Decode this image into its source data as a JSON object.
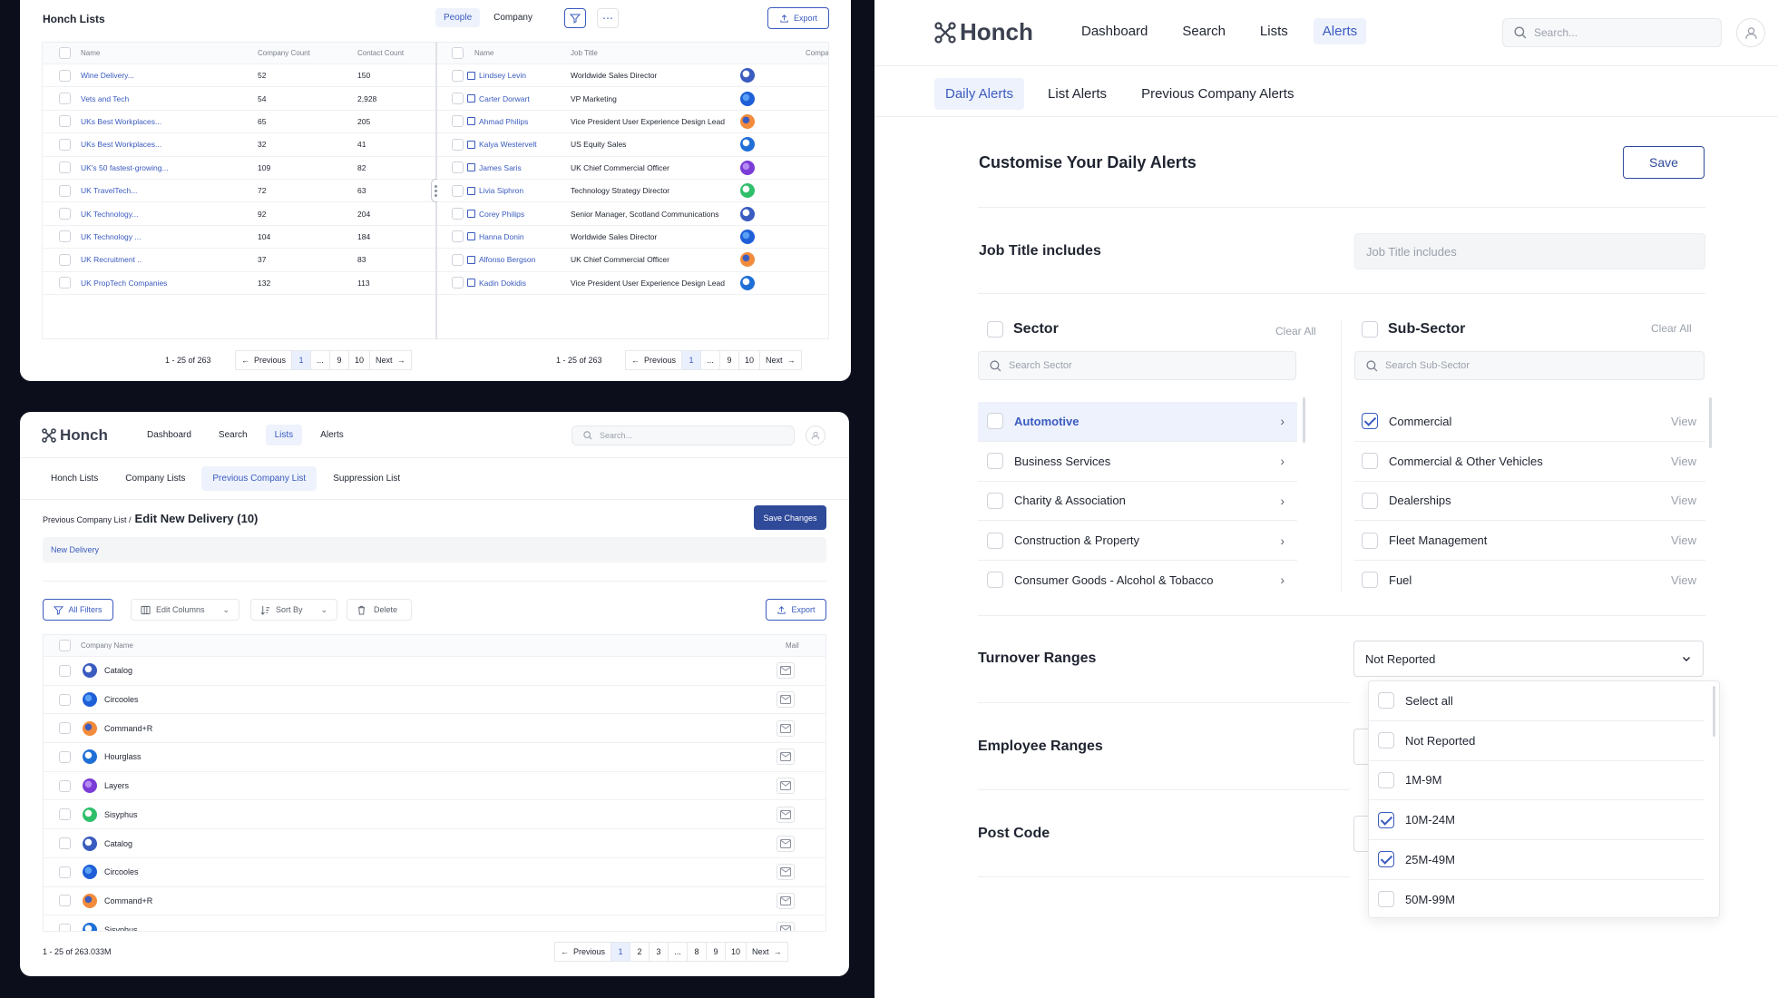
{
  "honch_lists": {
    "title": "Honch Lists",
    "toggle": {
      "people": "People",
      "company": "Company"
    },
    "export": "Export",
    "lists_table": {
      "headers": [
        "Name",
        "Company Count",
        "Contact Count"
      ],
      "rows": [
        [
          "Wine Delivery...",
          "52",
          "150"
        ],
        [
          "Vets and Tech",
          "54",
          "2,928"
        ],
        [
          "UKs Best Workplaces...",
          "65",
          "205"
        ],
        [
          "UKs Best Workplaces...",
          "32",
          "41"
        ],
        [
          "UK's 50 fastest-growing...",
          "109",
          "82"
        ],
        [
          "UK TravelTech...",
          "72",
          "63"
        ],
        [
          "UK Technology...",
          "92",
          "204"
        ],
        [
          "UK Technology ...",
          "104",
          "184"
        ],
        [
          "UK Recruitment ..",
          "37",
          "83"
        ],
        [
          "UK PropTech Companies",
          "132",
          "113"
        ]
      ]
    },
    "people_table": {
      "headers": [
        "Name",
        "Job Title",
        "Compa"
      ],
      "rows": [
        [
          "Lindsey Levin",
          "Worldwide Sales Director"
        ],
        [
          "Carter Dorwart",
          "VP Marketing"
        ],
        [
          "Ahmad Philips",
          "Vice President User Experience Design Lead"
        ],
        [
          "Kalya Westervelt",
          "US Equity Sales"
        ],
        [
          "James Saris",
          "UK Chief Commercial Officer"
        ],
        [
          "Livia Siphron",
          "Technology Strategy Director"
        ],
        [
          "Corey Philips",
          "Senior Manager, Scotland Communications"
        ],
        [
          "Hanna Donin",
          "Worldwide Sales Director"
        ],
        [
          "Alfonso Bergson",
          "UK Chief Commercial Officer"
        ],
        [
          "Kadin Dokidis",
          "Vice President User Experience Design Lead"
        ]
      ]
    },
    "pagination_left": {
      "range": "1 - 25 of 263",
      "prev": "Previous",
      "pages": [
        "1",
        "...",
        "9",
        "10"
      ],
      "next": "Next"
    },
    "pagination_right": {
      "range": "1 - 25 of 263",
      "prev": "Previous",
      "pages": [
        "1",
        "...",
        "9",
        "10"
      ],
      "next": "Next"
    }
  },
  "edit_list": {
    "logo": "Honch",
    "nav": [
      "Dashboard",
      "Search",
      "Lists",
      "Alerts"
    ],
    "search_placeholder": "Search...",
    "tabs": [
      "Honch Lists",
      "Company Lists",
      "Previous Company List",
      "Suppression List"
    ],
    "breadcrumb": "Previous Company List /",
    "title": "Edit New Delivery (10)",
    "save_changes": "Save Changes",
    "list_name": "New Delivery",
    "toolbar": {
      "all_filters": "All Filters",
      "edit_columns": "Edit Columns",
      "sort_by": "Sort By",
      "delete": "Delete",
      "export": "Export"
    },
    "table_headers": [
      "Company Name",
      "Mail"
    ],
    "companies": [
      "Catalog",
      "Circooles",
      "Command+R",
      "Hourglass",
      "Layers",
      "Sisyphus",
      "Catalog",
      "Circooles",
      "Command+R",
      "Sisyphus"
    ],
    "pagination": {
      "range": "1 - 25 of 263.033M",
      "prev": "Previous",
      "pages": [
        "1",
        "2",
        "3",
        "...",
        "8",
        "9",
        "10"
      ],
      "next": "Next"
    }
  },
  "alerts": {
    "logo": "Honch",
    "nav": [
      "Dashboard",
      "Search",
      "Lists",
      "Alerts"
    ],
    "search_placeholder": "Search...",
    "tabs": [
      "Daily Alerts",
      "List Alerts",
      "Previous Company Alerts"
    ],
    "heading": "Customise Your Daily Alerts",
    "save": "Save",
    "job_title_label": "Job Title includes",
    "job_title_placeholder": "Job Title includes",
    "sector": {
      "label": "Sector",
      "clear": "Clear All",
      "search_placeholder": "Search Sector",
      "items": [
        "Automotive",
        "Business Services",
        "Charity & Association",
        "Construction & Property",
        "Consumer Goods - Alcohol & Tobacco"
      ]
    },
    "subsector": {
      "label": "Sub-Sector",
      "clear": "Clear All",
      "search_placeholder": "Search Sub-Sector",
      "view": "View",
      "items": [
        "Commercial",
        "Commercial & Other Vehicles",
        "Dealerships",
        "Fleet Management",
        "Fuel"
      ]
    },
    "turnover_label": "Turnover Ranges",
    "turnover_value": "Not Reported",
    "employee_label": "Employee Ranges",
    "postcode_label": "Post Code",
    "dropdown_options": [
      "Select all",
      "Not Reported",
      "1M-9M",
      "10M-24M",
      "25M-49M",
      "50M-99M"
    ],
    "colors": {
      "accent": "#3a5bbf",
      "background": "#0c0f1b"
    }
  }
}
